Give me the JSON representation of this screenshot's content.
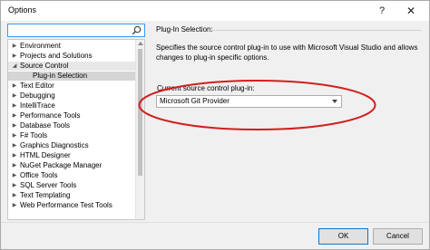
{
  "window": {
    "title": "Options",
    "help_glyph": "?",
    "close_glyph": "✕"
  },
  "search": {
    "value": "",
    "placeholder": ""
  },
  "tree": {
    "items": [
      {
        "label": "Environment",
        "expander": "▶",
        "level": 0
      },
      {
        "label": "Projects and Solutions",
        "expander": "▶",
        "level": 0
      },
      {
        "label": "Source Control",
        "expander": "◢",
        "level": 0,
        "selected": true
      },
      {
        "label": "Plug-in Selection",
        "expander": "",
        "level": 1,
        "selected": true
      },
      {
        "label": "Text Editor",
        "expander": "▶",
        "level": 0
      },
      {
        "label": "Debugging",
        "expander": "▶",
        "level": 0
      },
      {
        "label": "IntelliTrace",
        "expander": "▶",
        "level": 0
      },
      {
        "label": "Performance Tools",
        "expander": "▶",
        "level": 0
      },
      {
        "label": "Database Tools",
        "expander": "▶",
        "level": 0
      },
      {
        "label": "F# Tools",
        "expander": "▶",
        "level": 0
      },
      {
        "label": "Graphics Diagnostics",
        "expander": "▶",
        "level": 0
      },
      {
        "label": "HTML Designer",
        "expander": "▶",
        "level": 0
      },
      {
        "label": "NuGet Package Manager",
        "expander": "▶",
        "level": 0
      },
      {
        "label": "Office Tools",
        "expander": "▶",
        "level": 0
      },
      {
        "label": "SQL Server Tools",
        "expander": "▶",
        "level": 0
      },
      {
        "label": "Text Templating",
        "expander": "▶",
        "level": 0
      },
      {
        "label": "Web Performance Test Tools",
        "expander": "▶",
        "level": 0
      }
    ]
  },
  "panel": {
    "section_title": "Plug-In Selection:",
    "description": "Specifies the source control plug-in to use with Microsoft Visual Studio and allows changes to plug-in specific options.",
    "plugin_label": "Current source control plug-in:",
    "plugin_value": "Microsoft Git Provider"
  },
  "buttons": {
    "ok": "OK",
    "cancel": "Cancel"
  },
  "colors": {
    "highlight": "#d21f1f",
    "selection": "#d5d5d5",
    "focus": "#3399ff"
  }
}
